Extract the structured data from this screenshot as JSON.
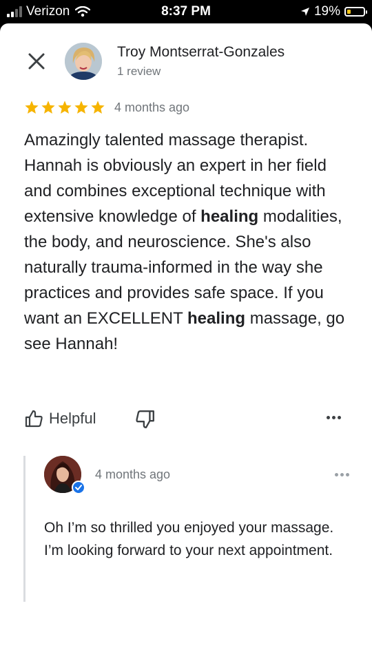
{
  "status_bar": {
    "carrier": "Verizon",
    "time": "8:37 PM",
    "battery_percent": "19%",
    "battery_level": 0.19,
    "icons": [
      "signal-icon",
      "wifi-icon",
      "location-arrow-icon",
      "battery-icon"
    ]
  },
  "review": {
    "reviewer_name": "Troy Montserrat-Gonzales",
    "review_count": "1 review",
    "rating": 5,
    "rating_max": 5,
    "star_color": "#f6b400",
    "date": "4 months ago",
    "text_parts": [
      "Amazingly talented massage therapist. Hannah is obviously an expert in her field and combines exceptional technique with extensive knowledge of ",
      "healing",
      " modalities, the body, and neuroscience. She's also naturally trauma-informed in the way she practices and provides safe space. If you want an EXCELLENT ",
      "healing",
      " massage, go see Hannah!"
    ],
    "helpful_label": "Helpful"
  },
  "reply": {
    "date": "4 months ago",
    "text": "Oh I’m so thrilled you enjoyed your massage. I’m looking forward to your next appointment.",
    "verified_color": "#1a73e8"
  }
}
